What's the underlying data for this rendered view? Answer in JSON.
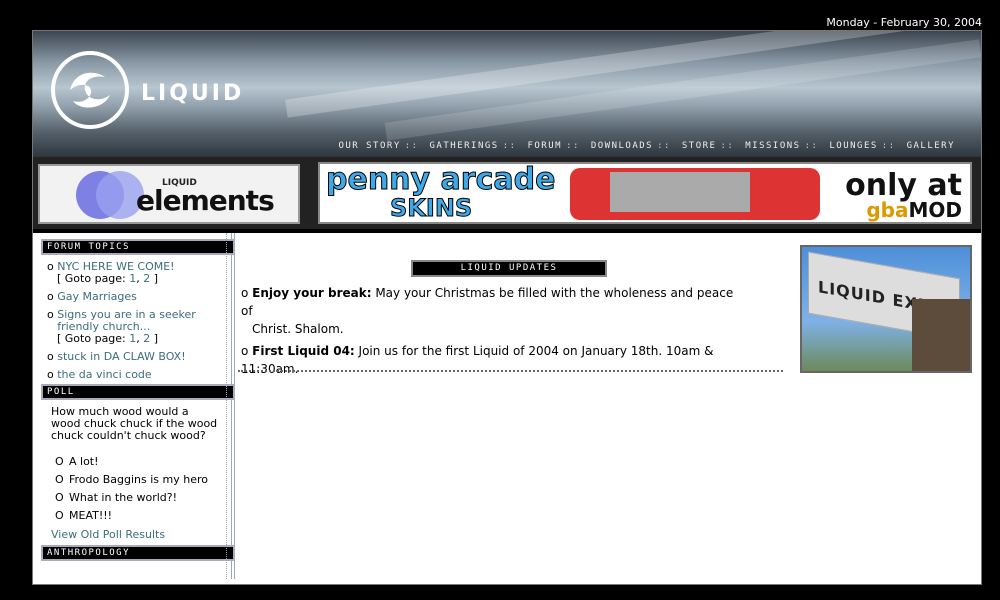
{
  "date_text": "Monday - February 30, 2004",
  "brand": "LIQUID",
  "nav": [
    "OUR STORY",
    "GATHERINGS",
    "FORUM",
    "DOWNLOADS",
    "STORE",
    "MISSIONS",
    "LOUNGES",
    "GALLERY"
  ],
  "ads": {
    "elements_small": "LIQUID",
    "elements_big": "elements",
    "pa_line1": "penny arcade",
    "pa_line2": "SKINS",
    "only_at": "only at",
    "gba": "gba",
    "mod": "MOD"
  },
  "sidebar": {
    "forum_title": "FORUM TOPICS",
    "forum_items": [
      {
        "title": "NYC HERE WE COME!",
        "goto_prefix": "[ Goto page: ",
        "pages": [
          "1",
          "2"
        ],
        "goto_suffix": " ]"
      },
      {
        "title": "Gay Marriages"
      },
      {
        "title": "Signs you are in a seeker friendly church...",
        "goto_prefix": "[ Goto page: ",
        "pages": [
          "1",
          "2"
        ],
        "goto_suffix": " ]"
      },
      {
        "title": "stuck in DA CLAW BOX!"
      },
      {
        "title": "the da vinci code"
      }
    ],
    "poll_title": "POLL",
    "poll_question": "How much wood would a wood chuck chuck if the wood chuck couldn't chuck wood?",
    "poll_options": [
      "A lot!",
      "Frodo Baggins is my hero",
      "What in the world?!",
      "MEAT!!!"
    ],
    "poll_old": "View Old Poll Results",
    "anthro_title": "ANTHROPOLOGY"
  },
  "content": {
    "updates_title": "LIQUID UPDATES",
    "news": [
      {
        "bullet": "o",
        "title": "Enjoy your break:",
        "text1": " May your Christmas be filled with the wholeness and peace of",
        "text2": "Christ. Shalom."
      },
      {
        "bullet": "o",
        "title": "First Liquid 04:",
        "text1": " Join us for the first Liquid of 2004 on January 18th. 10am & 11:30am."
      }
    ],
    "photo_text": "LIQUID EXP"
  }
}
